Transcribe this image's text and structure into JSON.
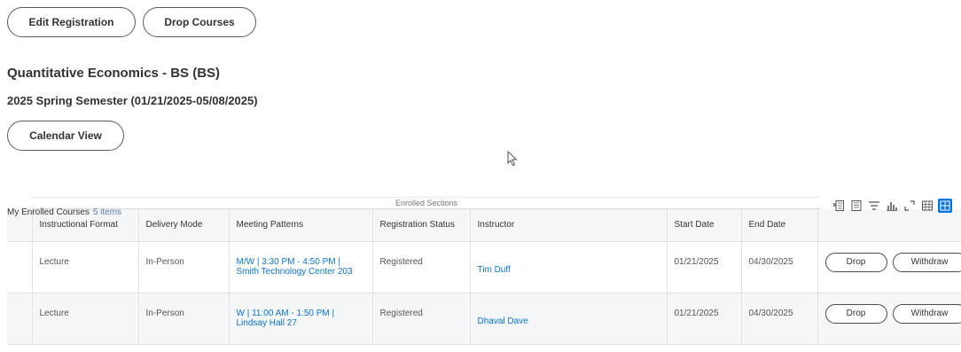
{
  "actions": {
    "edit_registration": "Edit Registration",
    "drop_courses": "Drop Courses",
    "calendar_view": "Calendar View"
  },
  "program": {
    "title": "Quantitative Economics - BS (BS)",
    "semester": "2025 Spring Semester (01/21/2025-05/08/2025)"
  },
  "enrolled": {
    "title": "My Enrolled Courses",
    "count": "5 items",
    "group_header": "Enrolled Sections",
    "columns": [
      "Instructional Format",
      "Delivery Mode",
      "Meeting Patterns",
      "Registration Status",
      "Instructor",
      "Start Date",
      "End Date"
    ],
    "rows": [
      {
        "format": "Lecture",
        "mode": "In-Person",
        "meeting": "M/W | 3:30 PM - 4:50 PM | Smith Technology Center 203",
        "status": "Registered",
        "instructor": "Tim Duff",
        "start": "01/21/2025",
        "end": "04/30/2025",
        "drop": "Drop",
        "withdraw": "Withdraw"
      },
      {
        "format": "Lecture",
        "mode": "In-Person",
        "meeting": "W | 11:00 AM - 1:50 PM | Lindsay Hall 27",
        "status": "Registered",
        "instructor": "Dhaval Dave",
        "start": "01/21/2025",
        "end": "04/30/2025",
        "drop": "Drop",
        "withdraw": "Withdraw"
      }
    ]
  },
  "toolbar_icons": [
    "export-excel-icon",
    "export-pdf-icon",
    "filter-icon",
    "chart-icon",
    "fullscreen-icon",
    "table-view-icon",
    "grid-view-icon"
  ],
  "accent_color": "#0875e1"
}
